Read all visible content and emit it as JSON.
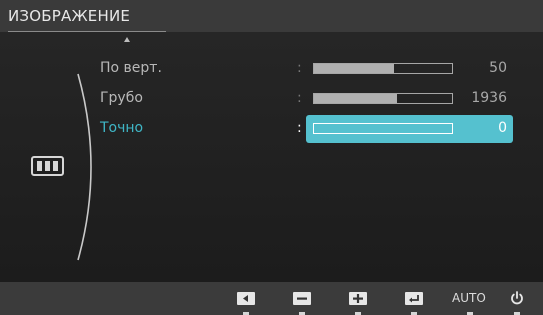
{
  "osd": {
    "title": "ИЗОБРАЖЕНИЕ",
    "category_icon": "picture-category-icon",
    "rows": [
      {
        "label": "По верт.",
        "separator": ":",
        "value": "50",
        "level": 0.58,
        "selected": false
      },
      {
        "label": "Грубо",
        "separator": ":",
        "value": "1936",
        "level": 0.6,
        "selected": false
      },
      {
        "label": "Точно",
        "separator": ":",
        "value": "0",
        "level": 0.0,
        "selected": true
      }
    ],
    "bottom_bar": {
      "buttons": [
        {
          "name": "left-arrow-button",
          "icon": "left-arrow-icon"
        },
        {
          "name": "minus-button",
          "icon": "minus-icon"
        },
        {
          "name": "plus-button",
          "icon": "plus-icon"
        },
        {
          "name": "enter-button",
          "icon": "enter-icon"
        },
        {
          "name": "auto-button",
          "label": "AUTO"
        },
        {
          "name": "power-button",
          "icon": "power-icon"
        }
      ]
    }
  },
  "colors": {
    "accent": "#55c1cf",
    "accent_text": "#3fb6c6",
    "background": "#202020",
    "title_bar": "#3a3a3a",
    "bottom_bar": "#3b3b3b"
  }
}
